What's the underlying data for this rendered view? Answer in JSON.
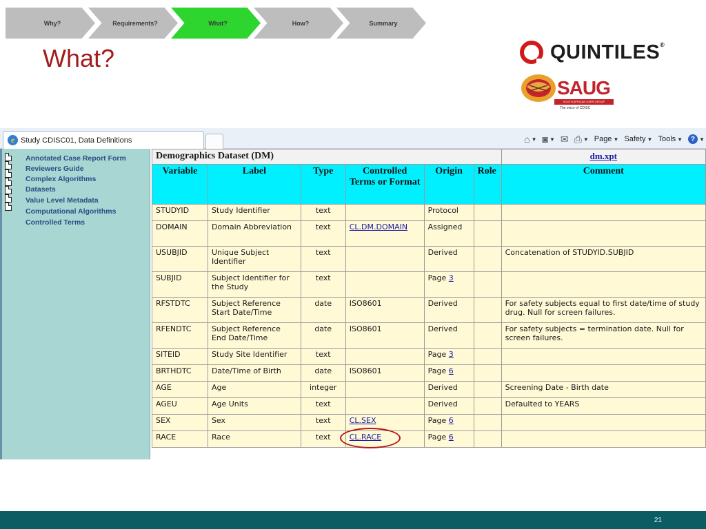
{
  "process": {
    "steps": [
      {
        "label": "Why?",
        "active": false
      },
      {
        "label": "Requirements?",
        "active": false
      },
      {
        "label": "What?",
        "active": true
      },
      {
        "label": "How?",
        "active": false
      },
      {
        "label": "Summary",
        "active": false
      }
    ]
  },
  "slide": {
    "title": "What?",
    "page_number": "21"
  },
  "logos": {
    "quintiles": "QUINTILES",
    "quintiles_mark": "®",
    "saug": "SAUG",
    "saug_bar": "SOUTH AFRICAN USER GROUP",
    "saug_tagline": "The voice of CDISC"
  },
  "browser": {
    "tab_title": "Study CDISC01, Data Definitions",
    "commands": {
      "page": "Page",
      "safety": "Safety",
      "tools": "Tools"
    }
  },
  "nav": {
    "items": [
      "Annotated Case Report Form",
      "Reviewers Guide",
      "Complex Algorithms",
      "Datasets",
      "Value Level Metadata",
      "Computational Algorithms",
      "Controlled Terms"
    ]
  },
  "dataset": {
    "title": "Demographics Dataset (DM)",
    "file": "dm.xpt",
    "columns": [
      "Variable",
      "Label",
      "Type",
      "Controlled Terms or Format",
      "Origin",
      "Role",
      "Comment"
    ],
    "rows": [
      {
        "variable": "STUDYID",
        "label": "Study Identifier",
        "type": "text",
        "format": "",
        "origin": "Protocol",
        "page": "",
        "role": "",
        "comment": ""
      },
      {
        "variable": "DOMAIN",
        "label": "Domain Abbreviation",
        "type": "text",
        "format": "CL.DM.DOMAIN",
        "origin": "Assigned",
        "page": "",
        "role": "",
        "comment": ""
      },
      {
        "variable": "USUBJID",
        "label": "Unique Subject Identifier",
        "type": "text",
        "format": "",
        "origin": "Derived",
        "page": "",
        "role": "",
        "comment": "Concatenation of STUDYID.SUBJID"
      },
      {
        "variable": "SUBJID",
        "label": "Subject Identifier for the Study",
        "type": "text",
        "format": "",
        "origin": "Page",
        "page": "3",
        "role": "",
        "comment": ""
      },
      {
        "variable": "RFSTDTC",
        "label": "Subject Reference Start Date/Time",
        "type": "date",
        "format": "ISO8601",
        "origin": "Derived",
        "page": "",
        "role": "",
        "comment": "For safety subjects equal to first date/time of study drug. Null for screen failures."
      },
      {
        "variable": "RFENDTC",
        "label": "Subject Reference End Date/Time",
        "type": "date",
        "format": "ISO8601",
        "origin": "Derived",
        "page": "",
        "role": "",
        "comment": "For safety subjects = termination date. Null for screen failures."
      },
      {
        "variable": "SITEID",
        "label": "Study Site Identifier",
        "type": "text",
        "format": "",
        "origin": "Page",
        "page": "3",
        "role": "",
        "comment": ""
      },
      {
        "variable": "BRTHDTC",
        "label": "Date/Time of Birth",
        "type": "date",
        "format": "ISO8601",
        "origin": "Page",
        "page": "6",
        "role": "",
        "comment": ""
      },
      {
        "variable": "AGE",
        "label": "Age",
        "type": "integer",
        "format": "",
        "origin": "Derived",
        "page": "",
        "role": "",
        "comment": "Screening Date - Birth date"
      },
      {
        "variable": "AGEU",
        "label": "Age Units",
        "type": "text",
        "format": "",
        "origin": "Derived",
        "page": "",
        "role": "",
        "comment": "Defaulted to YEARS"
      },
      {
        "variable": "SEX",
        "label": "Sex",
        "type": "text",
        "format": "CL.SEX",
        "origin": "Page",
        "page": "6",
        "role": "",
        "comment": ""
      },
      {
        "variable": "RACE",
        "label": "Race",
        "type": "text",
        "format": "CL.RACE",
        "origin": "Page",
        "page": "6",
        "role": "",
        "comment": ""
      }
    ]
  },
  "colors": {
    "title_red": "#a31b1b",
    "chevron_active": "#2fd52f",
    "chevron_inactive": "#bdbdbd",
    "header_cyan": "#00f0ff",
    "row_fill": "#fff9d6",
    "nav_bg": "#a8d6d3",
    "footer": "#0c5c64"
  }
}
